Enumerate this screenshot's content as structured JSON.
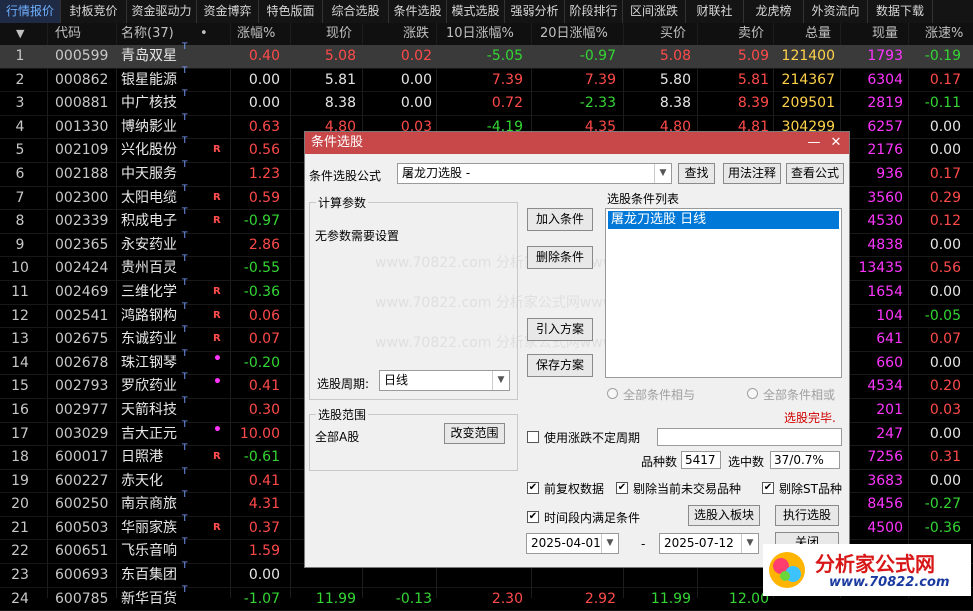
{
  "tabs": [
    "行情报价",
    "封板竞价",
    "资金驱动力",
    "资金博弈",
    "特色版面",
    "综合选股",
    "条件选股",
    "模式选股",
    "强弱分析",
    "阶段排行",
    "区间涨跌",
    "财联社",
    "龙虎榜",
    "外资流向",
    "数据下载"
  ],
  "active_tab": 0,
  "header": {
    "sort_icon": "▼",
    "code": "代码",
    "name": "名称(37)",
    "dot": "•",
    "pct": "涨幅%",
    "price": "现价",
    "change": "涨跌",
    "d10": "10日涨幅%",
    "d20": "20日涨幅%",
    "bid": "买价",
    "ask": "卖价",
    "vol": "总量",
    "cur": "现量",
    "speed": "涨速%"
  },
  "rows": [
    {
      "i": "1",
      "code": "000599",
      "name": "青岛双星",
      "flag": "",
      "pct": "0.40",
      "price": "5.08",
      "chg": "0.02",
      "d10": "-5.05",
      "d20": "-0.97",
      "bid": "5.08",
      "ask": "5.09",
      "vol": "121400",
      "cur": "1793",
      "spd": "-0.19"
    },
    {
      "i": "2",
      "code": "000862",
      "name": "银星能源",
      "flag": "",
      "pct": "0.00",
      "price": "5.81",
      "chg": "0.00",
      "d10": "7.39",
      "d20": "7.39",
      "bid": "5.80",
      "ask": "5.81",
      "vol": "214367",
      "cur": "6304",
      "spd": "0.17"
    },
    {
      "i": "3",
      "code": "000881",
      "name": "中广核技",
      "flag": "",
      "pct": "0.00",
      "price": "8.38",
      "chg": "0.00",
      "d10": "0.72",
      "d20": "-2.33",
      "bid": "8.38",
      "ask": "8.39",
      "vol": "209501",
      "cur": "2819",
      "spd": "-0.11"
    },
    {
      "i": "4",
      "code": "001330",
      "name": "博纳影业",
      "flag": "",
      "pct": "0.63",
      "price": "4.80",
      "chg": "0.03",
      "d10": "-4.19",
      "d20": "4.35",
      "bid": "4.80",
      "ask": "4.81",
      "vol": "304299",
      "cur": "6257",
      "spd": "0.00"
    },
    {
      "i": "5",
      "code": "002109",
      "name": "兴化股份",
      "flag": "R",
      "pct": "0.56",
      "price": "",
      "chg": "",
      "d10": "",
      "d20": "",
      "bid": "",
      "ask": "",
      "vol": "",
      "cur": "2176",
      "spd": "0.00"
    },
    {
      "i": "6",
      "code": "002188",
      "name": "中天服务",
      "flag": "",
      "pct": "1.23",
      "price": "",
      "chg": "",
      "d10": "",
      "d20": "",
      "bid": "",
      "ask": "",
      "vol": "",
      "cur": "936",
      "spd": "0.17"
    },
    {
      "i": "7",
      "code": "002300",
      "name": "太阳电缆",
      "flag": "R",
      "pct": "0.59",
      "price": "",
      "chg": "",
      "d10": "",
      "d20": "",
      "bid": "",
      "ask": "",
      "vol": "",
      "cur": "3560",
      "spd": "0.29"
    },
    {
      "i": "8",
      "code": "002339",
      "name": "积成电子",
      "flag": "R",
      "pct": "-0.97",
      "price": "",
      "chg": "",
      "d10": "",
      "d20": "",
      "bid": "",
      "ask": "",
      "vol": "",
      "cur": "4530",
      "spd": "0.12"
    },
    {
      "i": "9",
      "code": "002365",
      "name": "永安药业",
      "flag": "",
      "pct": "2.86",
      "price": "",
      "chg": "",
      "d10": "",
      "d20": "",
      "bid": "",
      "ask": "",
      "vol": "",
      "cur": "4838",
      "spd": "0.00"
    },
    {
      "i": "10",
      "code": "002424",
      "name": "贵州百灵",
      "flag": "",
      "pct": "-0.55",
      "price": "",
      "chg": "",
      "d10": "",
      "d20": "",
      "bid": "",
      "ask": "",
      "vol": "",
      "cur": "13435",
      "spd": "0.56"
    },
    {
      "i": "11",
      "code": "002469",
      "name": "三维化学",
      "flag": "R",
      "pct": "-0.36",
      "price": "",
      "chg": "",
      "d10": "",
      "d20": "",
      "bid": "",
      "ask": "",
      "vol": "",
      "cur": "1654",
      "spd": "0.00"
    },
    {
      "i": "12",
      "code": "002541",
      "name": "鸿路钢构",
      "flag": "R",
      "pct": "0.06",
      "price": "",
      "chg": "",
      "d10": "",
      "d20": "",
      "bid": "",
      "ask": "",
      "vol": "",
      "cur": "104",
      "spd": "-0.05"
    },
    {
      "i": "13",
      "code": "002675",
      "name": "东诚药业",
      "flag": "R",
      "pct": "0.07",
      "price": "",
      "chg": "",
      "d10": "",
      "d20": "",
      "bid": "",
      "ask": "",
      "vol": "",
      "cur": "641",
      "spd": "0.07"
    },
    {
      "i": "14",
      "code": "002678",
      "name": "珠江钢琴",
      "flag": "•",
      "pct": "-0.20",
      "price": "",
      "chg": "",
      "d10": "",
      "d20": "",
      "bid": "",
      "ask": "",
      "vol": "",
      "cur": "660",
      "spd": "0.00"
    },
    {
      "i": "15",
      "code": "002793",
      "name": "罗欣药业",
      "flag": "•",
      "pct": "0.41",
      "price": "",
      "chg": "",
      "d10": "",
      "d20": "",
      "bid": "",
      "ask": "",
      "vol": "",
      "cur": "4534",
      "spd": "0.20"
    },
    {
      "i": "16",
      "code": "002977",
      "name": "天箭科技",
      "flag": "",
      "pct": "0.30",
      "price": "",
      "chg": "",
      "d10": "",
      "d20": "",
      "bid": "",
      "ask": "",
      "vol": "",
      "cur": "201",
      "spd": "0.03"
    },
    {
      "i": "17",
      "code": "003029",
      "name": "吉大正元",
      "flag": "•",
      "pct": "10.00",
      "price": "",
      "chg": "",
      "d10": "",
      "d20": "",
      "bid": "",
      "ask": "",
      "vol": "",
      "cur": "247",
      "spd": "0.00"
    },
    {
      "i": "18",
      "code": "600017",
      "name": "日照港",
      "flag": "R",
      "pct": "-0.61",
      "price": "",
      "chg": "",
      "d10": "",
      "d20": "",
      "bid": "",
      "ask": "",
      "vol": "",
      "cur": "7256",
      "spd": "0.31"
    },
    {
      "i": "19",
      "code": "600227",
      "name": "赤天化",
      "flag": "",
      "pct": "0.41",
      "price": "",
      "chg": "",
      "d10": "",
      "d20": "",
      "bid": "",
      "ask": "",
      "vol": "",
      "cur": "3683",
      "spd": "0.00"
    },
    {
      "i": "20",
      "code": "600250",
      "name": "南京商旅",
      "flag": "",
      "pct": "4.31",
      "price": "",
      "chg": "",
      "d10": "",
      "d20": "",
      "bid": "",
      "ask": "",
      "vol": "",
      "cur": "8456",
      "spd": "-0.27"
    },
    {
      "i": "21",
      "code": "600503",
      "name": "华丽家族",
      "flag": "R",
      "pct": "0.37",
      "price": "",
      "chg": "",
      "d10": "",
      "d20": "",
      "bid": "",
      "ask": "",
      "vol": "",
      "cur": "4500",
      "spd": "-0.36"
    },
    {
      "i": "22",
      "code": "600651",
      "name": "飞乐音响",
      "flag": "",
      "pct": "1.59",
      "price": "",
      "chg": "",
      "d10": "",
      "d20": "",
      "bid": "",
      "ask": "",
      "vol": "",
      "cur": "",
      "spd": ""
    },
    {
      "i": "23",
      "code": "600693",
      "name": "东百集团",
      "flag": "",
      "pct": "0.00",
      "price": "",
      "chg": "",
      "d10": "",
      "d20": "",
      "bid": "",
      "ask": "",
      "vol": "",
      "cur": "",
      "spd": ""
    },
    {
      "i": "24",
      "code": "600785",
      "name": "新华百货",
      "flag": "",
      "pct": "-1.07",
      "price": "11.99",
      "chg": "-0.13",
      "d10": "2.30",
      "d20": "2.92",
      "bid": "11.99",
      "ask": "12.00",
      "vol": "",
      "cur": "",
      "spd": ""
    }
  ],
  "dialog": {
    "title": "条件选股",
    "minimize": "—",
    "close": "✕",
    "formula_label": "条件选股公式",
    "formula_value": "屠龙刀选股  -",
    "find": "查找",
    "usage": "用法注释",
    "view": "查看公式",
    "calc_params": "计算参数",
    "no_params": "无参数需要设置",
    "period_label": "选股周期:",
    "period_value": "日线",
    "range_title": "选股范围",
    "range_value": "全部A股",
    "change_range": "改变范围",
    "add_cond": "加入条件",
    "del_cond": "删除条件",
    "import_plan": "引入方案",
    "save_plan": "保存方案",
    "cond_list_title": "选股条件列表",
    "cond_item": "屠龙刀选股  日线",
    "all_and": "全部条件相与",
    "all_or": "全部条件相或",
    "done": "选股完毕.",
    "use_period": "使用涨跌不定周期",
    "count_label": "品种数",
    "count_value": "5417",
    "selected_label": "选中数",
    "selected_value": "37/0.7%",
    "pre_restore": "前复权数据",
    "exclude_untraded": "剔除当前未交易品种",
    "exclude_st": "剔除ST品种",
    "time_cond": "时间段内满足条件",
    "to_board": "选股入板块",
    "run": "执行选股",
    "date_from": "2025-04-01",
    "dash": "-",
    "date_to": "2025-07-12",
    "close_btn": "关闭",
    "watermark": "www.70822.com  分析家公式网www"
  },
  "logo": {
    "name": "分析家公式网",
    "url": "www.70822.com"
  },
  "colors": {
    "up": "#ff4a4a",
    "down": "#33d633",
    "vol": "#ffd24a",
    "cur": "#ff36ff",
    "title_bar": "#c8484a",
    "select": "#0078d7"
  }
}
